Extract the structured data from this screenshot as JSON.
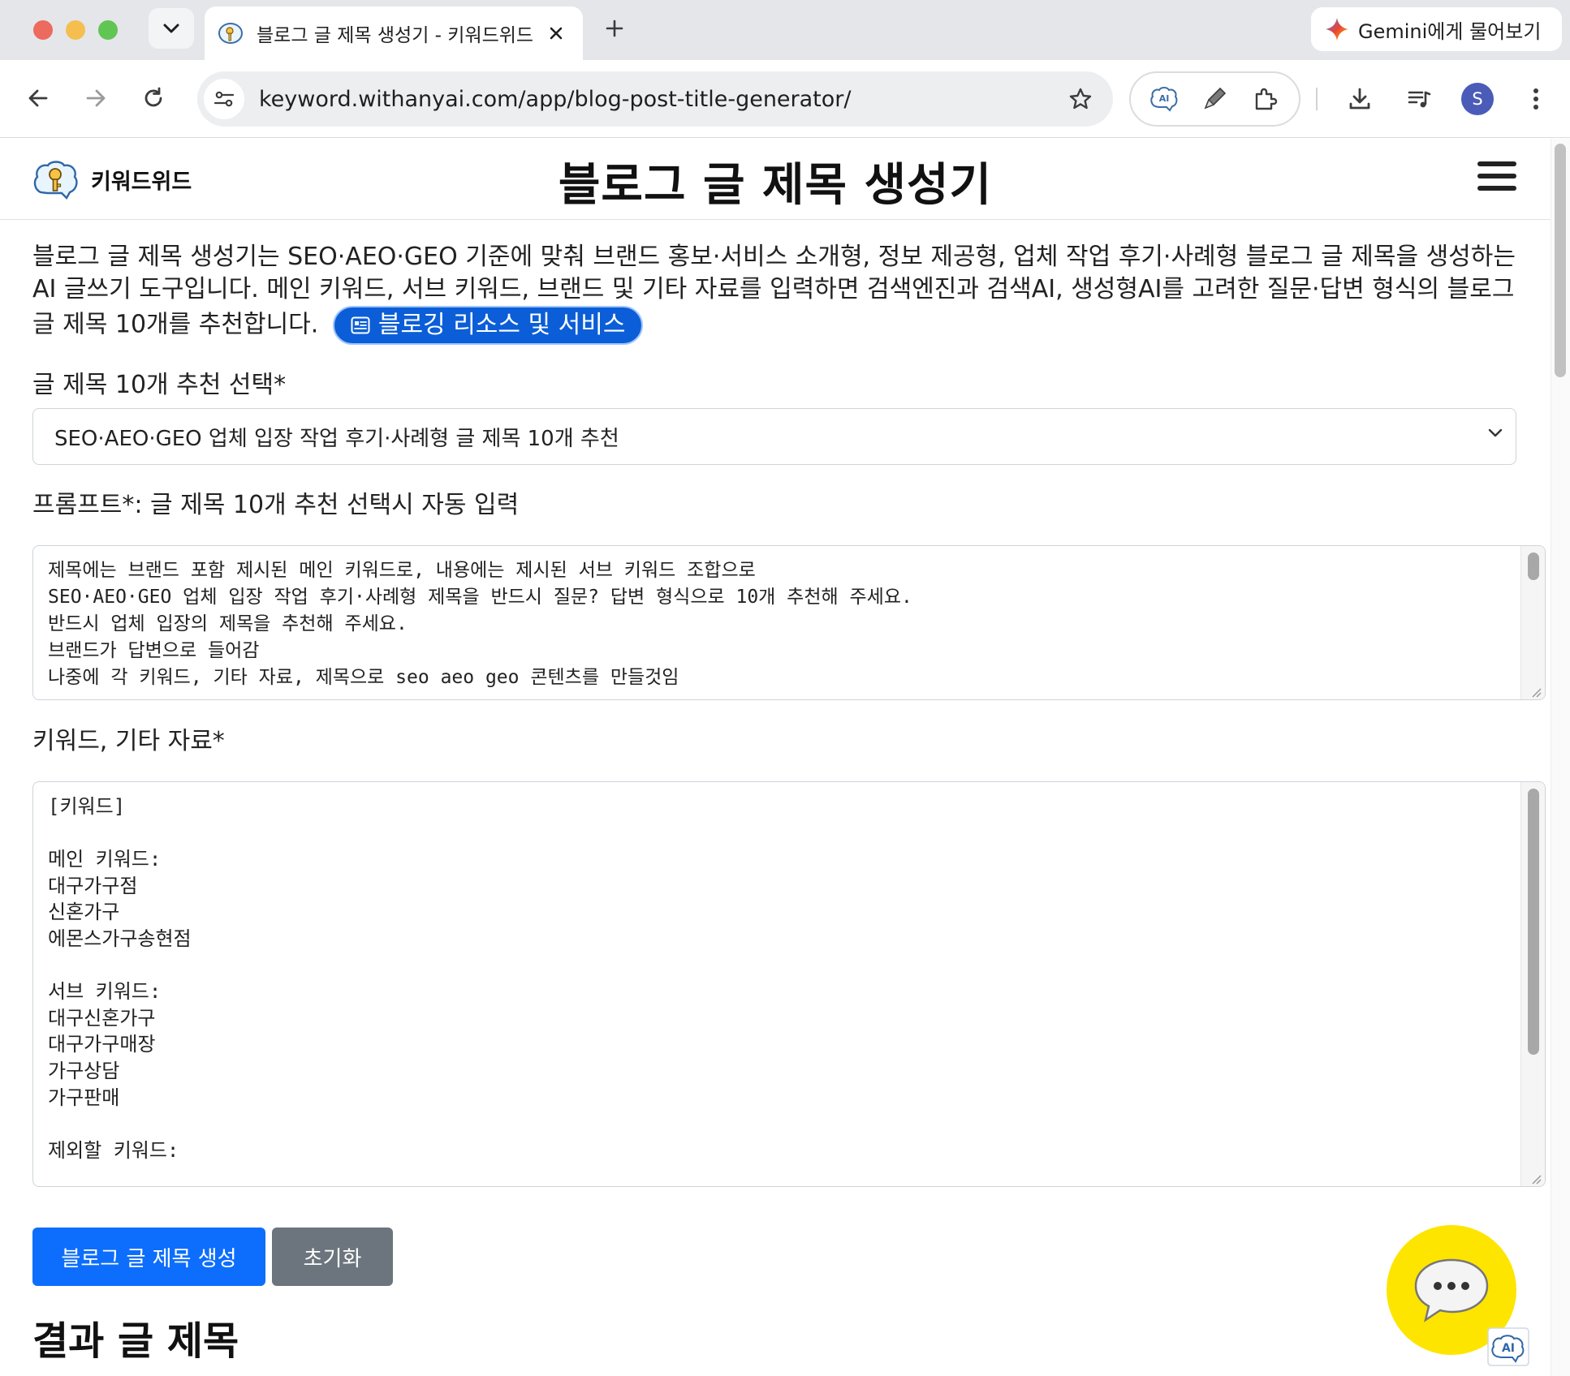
{
  "browser": {
    "tab_title": "블로그 글 제목 생성기 - 키워드위드",
    "gemini_label": "Gemini에게 물어보기",
    "url": "keyword.withanyai.com/app/blog-post-title-generator/",
    "profile_initial": "S",
    "ext_ai_label": "AI"
  },
  "header": {
    "brand_name": "키워드위드",
    "page_title": "블로그 글 제목 생성기"
  },
  "intro": {
    "text": "블로그 글 제목 생성기는 SEO·AEO·GEO 기준에 맞춰 브랜드 홍보·서비스 소개형, 정보 제공형, 업체 작업 후기·사례형 블로그 글 제목을 생성하는 AI 글쓰기 도구입니다. 메인 키워드, 서브 키워드, 브랜드 및 기타 자료를 입력하면 검색엔진과 검색AI, 생성형AI를 고려한 질문·답변 형식의 블로그 글 제목 10개를 추천합니다.",
    "pill_label": "블로깅 리소스 및 서비스"
  },
  "form": {
    "select_label": "글 제목 10개 추천 선택*",
    "select_value": "SEO·AEO·GEO 업체 입장 작업 후기·사례형 글 제목 10개 추천",
    "prompt_label": "프롬프트*: 글 제목 10개 추천 선택시 자동 입력",
    "prompt_text": "제목에는 브랜드 포함 제시된 메인 키워드로, 내용에는 제시된 서브 키워드 조합으로\nSEO·AEO·GEO 업체 입장 작업 후기·사례형 제목을 반드시 질문? 답변 형식으로 10개 추천해 주세요.\n반드시 업체 입장의 제목을 추천해 주세요.\n브랜드가 답변으로 들어감\n나중에 각 키워드, 기타 자료, 제목으로 seo aeo geo 콘텐츠를 만들것임",
    "keywords_label": "키워드, 기타 자료*",
    "keywords_text": "[키워드]\n\n메인 키워드:\n대구가구점\n신혼가구\n에몬스가구송현점\n\n서브 키워드:\n대구신혼가구\n대구가구매장\n가구상담\n가구판매\n\n제외할 키워드:"
  },
  "actions": {
    "generate_label": "블로그 글 제목 생성",
    "reset_label": "초기화"
  },
  "result": {
    "heading": "결과 글 제목"
  },
  "widgets": {
    "ai_badge_label": "AI"
  },
  "colors": {
    "primary": "#0d6efd",
    "secondary": "#6c757d",
    "pill": "#0b5ed7",
    "chat_fab": "#fde500"
  }
}
